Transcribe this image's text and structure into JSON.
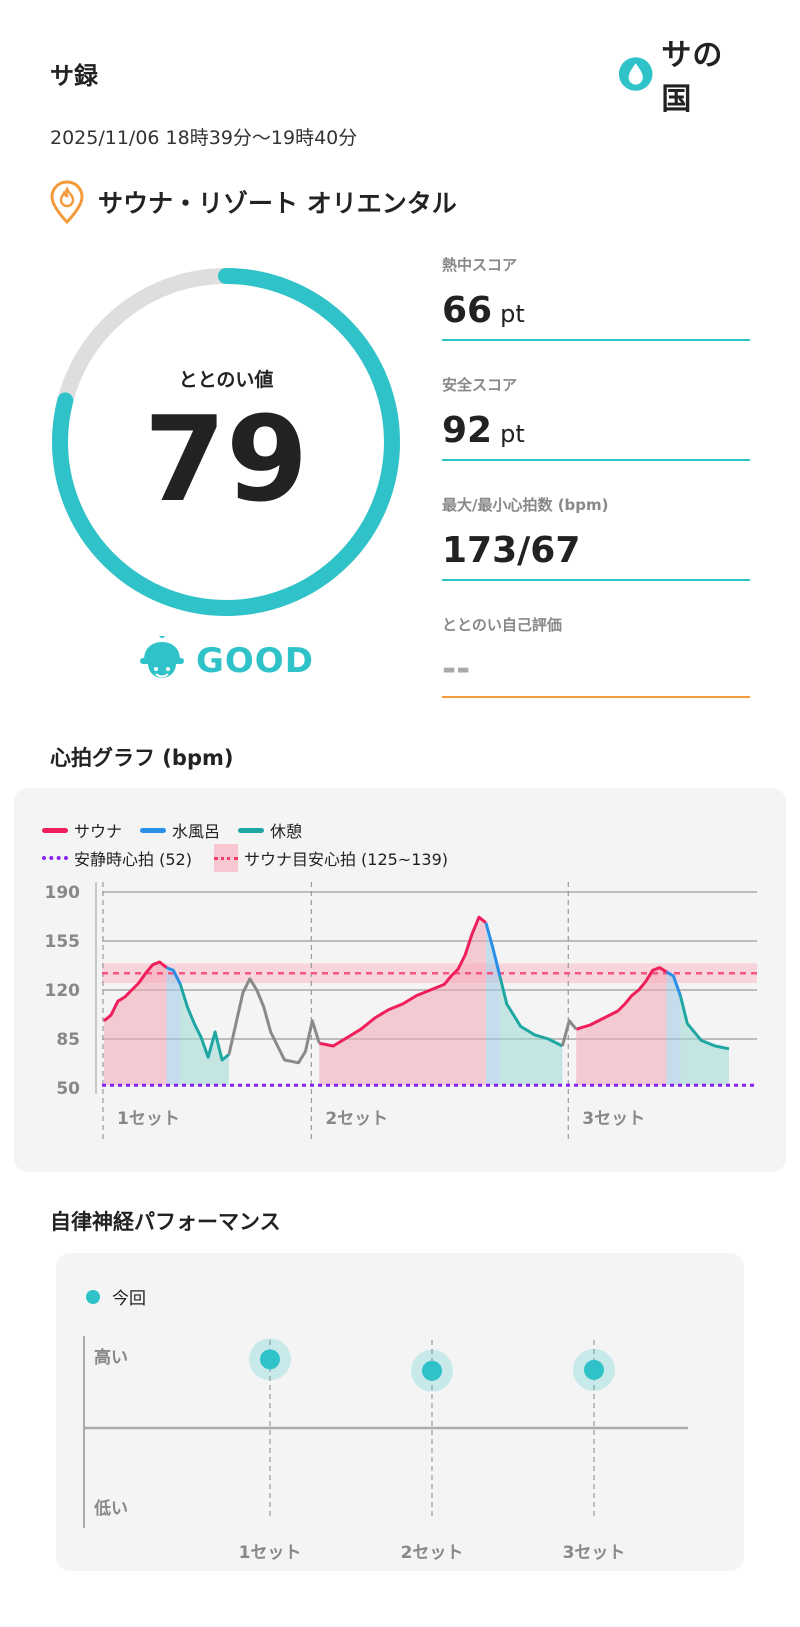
{
  "header": {
    "app_title": "サ録",
    "logo_text": "サの国",
    "logo_icon": "water-drop-icon"
  },
  "session": {
    "datetime": "2025/11/06 18時39分〜19時40分",
    "facility_icon": "fire-pin-icon",
    "facility_name": "サウナ・リゾート オリエンタル"
  },
  "score": {
    "label": "ととのい値",
    "value": "79",
    "fraction": 0.79,
    "rating_icon": "sauna-hat-face-icon",
    "rating": "GOOD"
  },
  "stats": [
    {
      "label": "熱中スコア",
      "value": "66",
      "unit": "pt"
    },
    {
      "label": "安全スコア",
      "value": "92",
      "unit": "pt"
    },
    {
      "label": "最大/最小心拍数 (bpm)",
      "value": "173/67",
      "unit": ""
    },
    {
      "label": "ととのい自己評価",
      "value": "--",
      "unit": ""
    }
  ],
  "heart_graph": {
    "title": "心拍グラフ (bpm)",
    "legend": {
      "sauna": "サウナ",
      "cold_bath": "水風呂",
      "rest": "休憩",
      "resting_hr": "安静時心拍 (52)",
      "sauna_target": "サウナ目安心拍 (125~139)"
    }
  },
  "colors": {
    "accent": "#2fc3c9",
    "sauna": "#ee1f5a",
    "cold_bath": "#2a8fe6",
    "rest": "#1fa7a3",
    "transition": "#8a8a8a",
    "resting_hr": "#8a22f0",
    "target": "#f4557d",
    "orange": "#f39a3a"
  },
  "chart_data": [
    {
      "type": "line",
      "title": "心拍グラフ (bpm)",
      "ylabel": "",
      "xlabel": "",
      "ylim": [
        50,
        190
      ],
      "yticks": [
        190,
        155,
        120,
        85,
        50
      ],
      "grid": true,
      "legend_position": "top-left",
      "resting_hr": 52,
      "target_band": [
        125,
        139
      ],
      "target_line": 132,
      "set_labels": [
        "1セット",
        "2セット",
        "3セット"
      ],
      "set_starts": [
        0,
        30,
        67
      ],
      "x_max": 90,
      "x_unit": "relative",
      "series": [
        {
          "name": "サウナ",
          "segments": [
            {
              "x": [
                0,
                1,
                2,
                3,
                4,
                5,
                6,
                7,
                8,
                9
              ],
              "y": [
                98,
                102,
                112,
                115,
                120,
                125,
                132,
                138,
                140,
                136
              ]
            },
            {
              "x": [
                31,
                33,
                35,
                37,
                39,
                41,
                43,
                45,
                47,
                49,
                50,
                51,
                52,
                53,
                54,
                55
              ],
              "y": [
                82,
                80,
                86,
                92,
                100,
                106,
                110,
                116,
                120,
                124,
                130,
                135,
                145,
                160,
                172,
                168
              ]
            },
            {
              "x": [
                68,
                70,
                72,
                74,
                75,
                76,
                77,
                78,
                79,
                80,
                81
              ],
              "y": [
                92,
                95,
                100,
                105,
                110,
                116,
                120,
                126,
                134,
                136,
                133
              ]
            }
          ]
        },
        {
          "name": "水風呂",
          "segments": [
            {
              "x": [
                9,
                10,
                11
              ],
              "y": [
                136,
                134,
                124
              ]
            },
            {
              "x": [
                55,
                56,
                57
              ],
              "y": [
                168,
                150,
                130
              ]
            },
            {
              "x": [
                81,
                82,
                83
              ],
              "y": [
                133,
                130,
                116
              ]
            }
          ]
        },
        {
          "name": "休憩",
          "segments": [
            {
              "x": [
                11,
                12,
                13,
                14,
                15,
                16,
                17,
                18
              ],
              "y": [
                124,
                108,
                96,
                86,
                72,
                90,
                70,
                74
              ]
            },
            {
              "x": [
                57,
                58,
                60,
                62,
                64,
                66
              ],
              "y": [
                130,
                110,
                94,
                88,
                85,
                80
              ]
            },
            {
              "x": [
                83,
                84,
                86,
                88,
                90
              ],
              "y": [
                116,
                96,
                84,
                80,
                78
              ]
            }
          ]
        },
        {
          "name": "",
          "segments": [
            {
              "x": [
                18,
                19,
                20,
                21,
                22,
                23,
                24,
                26,
                28,
                29,
                30,
                31
              ],
              "y": [
                74,
                96,
                118,
                128,
                120,
                108,
                90,
                70,
                68,
                76,
                98,
                82
              ]
            },
            {
              "x": [
                66,
                67,
                68
              ],
              "y": [
                80,
                98,
                92
              ]
            }
          ]
        }
      ]
    },
    {
      "type": "scatter",
      "title": "自律神経パフォーマンス",
      "categories": [
        "1セット",
        "2セット",
        "3セット"
      ],
      "yticks": [
        "高い",
        "低い"
      ],
      "series": [
        {
          "name": "今回",
          "values": [
            0.78,
            0.65,
            0.66
          ]
        }
      ],
      "ylim": [
        -1,
        1
      ]
    }
  ],
  "ans": {
    "title": "自律神経パフォーマンス",
    "legend": "今回",
    "high_label": "高い",
    "low_label": "低い",
    "sets": [
      "1セット",
      "2セット",
      "3セット"
    ]
  }
}
